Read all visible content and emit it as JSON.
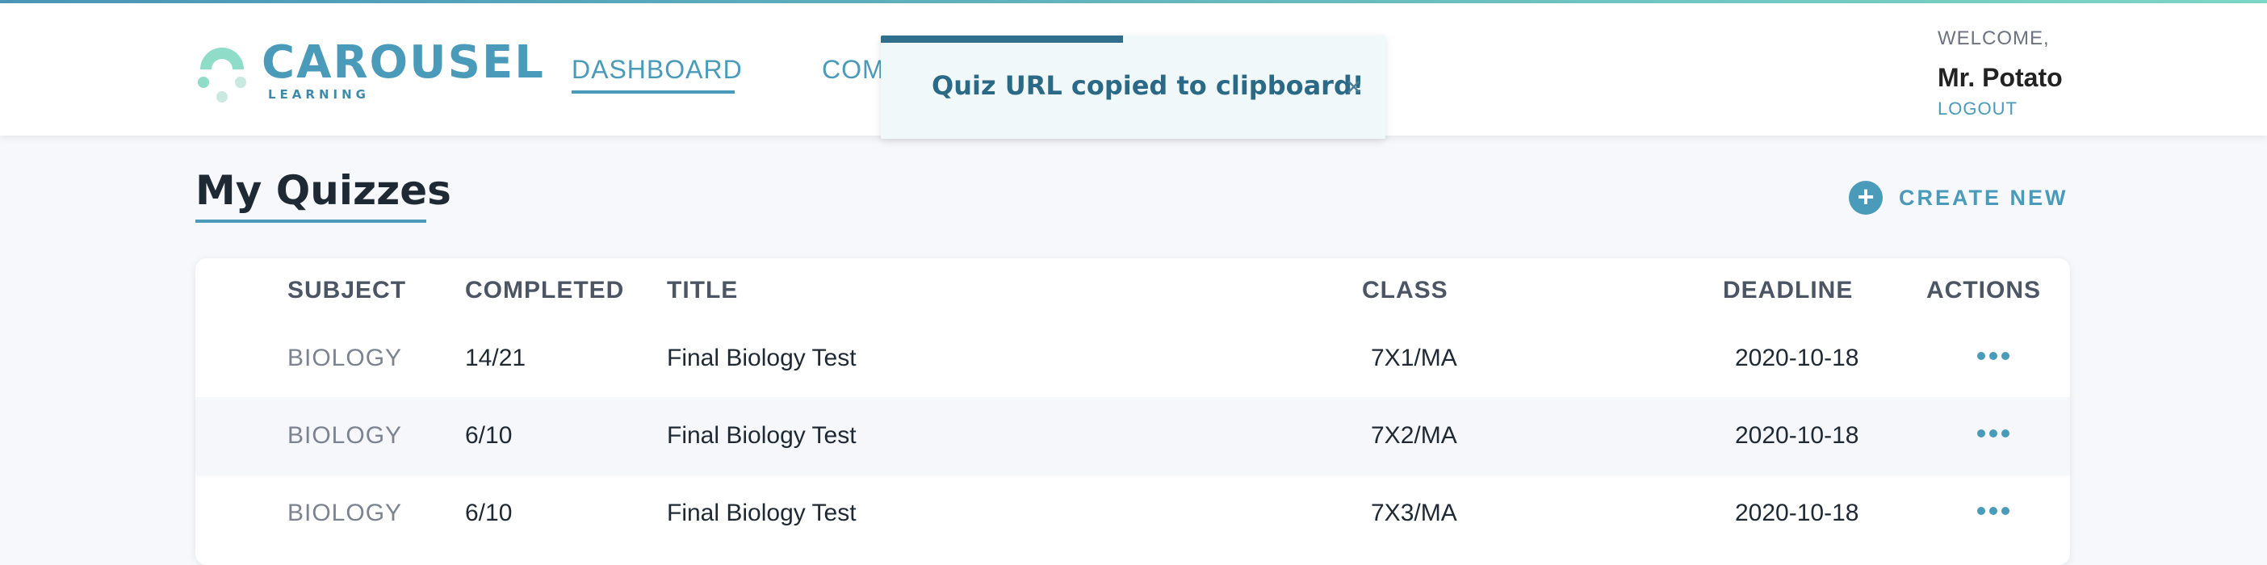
{
  "header": {
    "logo": {
      "word": "CAROUSEL",
      "sub": "LEARNING"
    },
    "nav": {
      "dashboard": "DASHBOARD",
      "second": "COM"
    },
    "user": {
      "welcome": "WELCOME,",
      "name": "Mr. Potato",
      "logout": "LOGOUT"
    }
  },
  "toast": {
    "message": "Quiz URL copied to clipboard!",
    "close": "×",
    "progress": 0.48
  },
  "page": {
    "title": "My Quizzes",
    "create_new": "CREATE NEW"
  },
  "table": {
    "headers": [
      "SUBJECT",
      "COMPLETED",
      "TITLE",
      "CLASS",
      "DEADLINE",
      "ACTIONS"
    ],
    "rows": [
      {
        "subject": "BIOLOGY",
        "completed": "14/21",
        "title": "Final Biology Test",
        "class": "7X1/MA",
        "deadline": "2020-10-18"
      },
      {
        "subject": "BIOLOGY",
        "completed": "6/10",
        "title": "Final Biology Test",
        "class": "7X2/MA",
        "deadline": "2020-10-18"
      },
      {
        "subject": "BIOLOGY",
        "completed": "6/10",
        "title": "Final Biology Test",
        "class": "7X3/MA",
        "deadline": "2020-10-18"
      }
    ]
  },
  "colors": {
    "accent": "#4a9ab9",
    "toast_bg": "#f1f8fa",
    "toast_text": "#2b6a86",
    "logo_mint": "#8fdcc8"
  },
  "icons": {
    "logo": "carousel-logo-icon",
    "close": "close-icon",
    "add": "plus-circle-icon",
    "actions": "more-horizontal-icon"
  }
}
